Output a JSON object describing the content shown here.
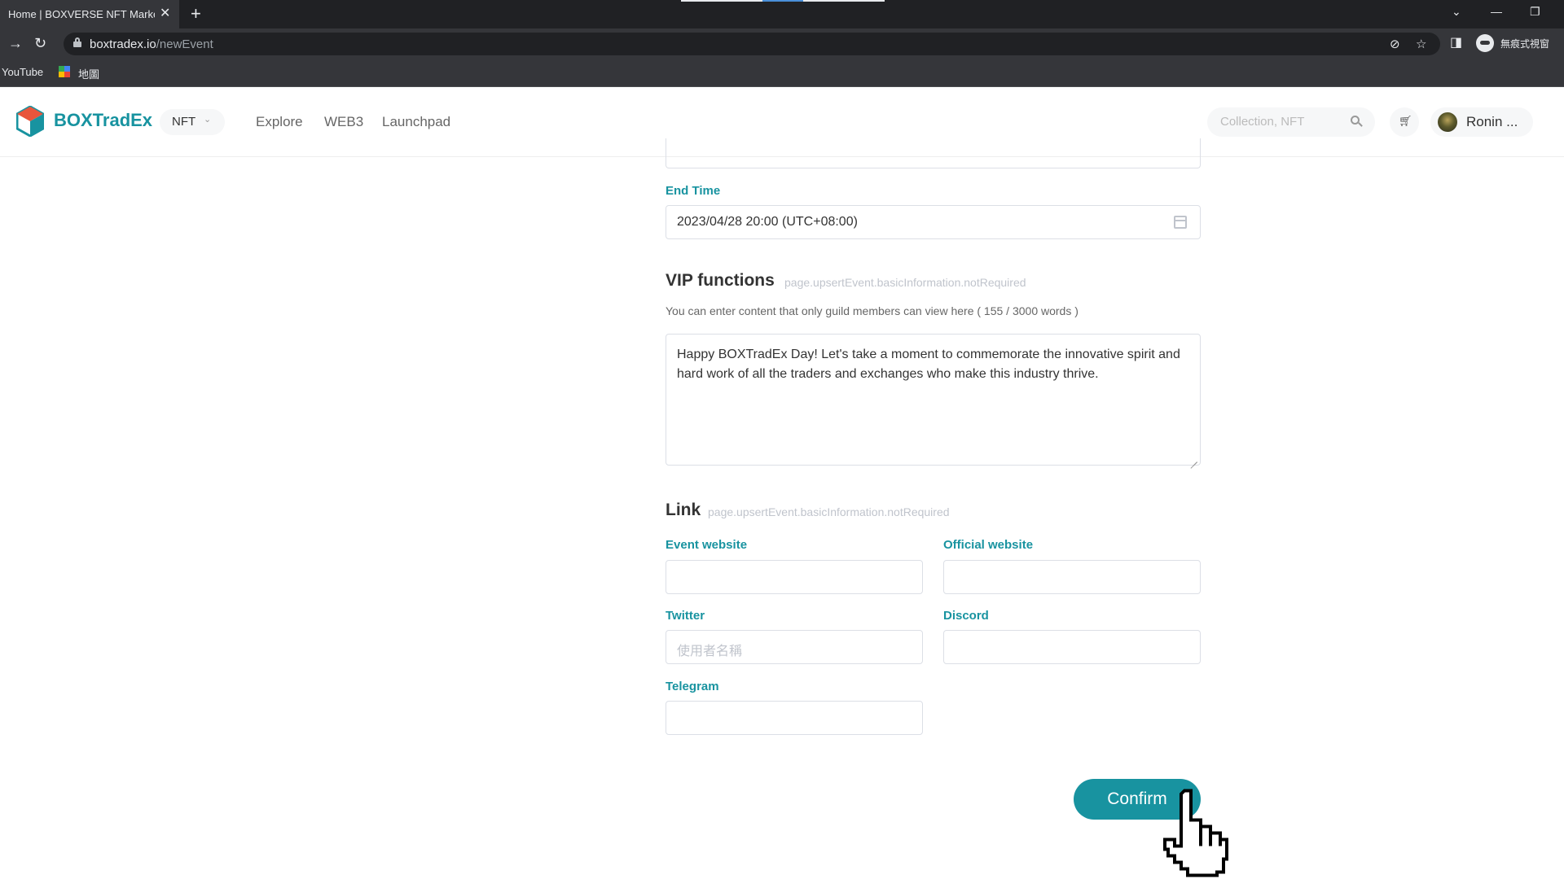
{
  "browser": {
    "tab_title": "Home | BOXVERSE NFT Market",
    "tab_close": "✕",
    "new_tab": "+",
    "url_host": "boxtradex.io",
    "url_path": "/newEvent",
    "profile_label": "無痕式視窗",
    "bookmarks": [
      "YouTube",
      "地圖"
    ],
    "window_controls": [
      "⌄",
      "—",
      "❐"
    ]
  },
  "header": {
    "brand": "BOXTradEx",
    "nft_selector": "NFT",
    "nav": [
      "Explore",
      "WEB3",
      "Launchpad"
    ],
    "search_placeholder": "Collection, NFT",
    "user_name": "Ronin ..."
  },
  "form": {
    "end_time": {
      "label": "End Time",
      "value": "2023/04/28 20:00 (UTC+08:00)"
    },
    "vip": {
      "title": "VIP functions",
      "note": "page.upsertEvent.basicInformation.notRequired",
      "help": "You can enter content that only guild members can view here ( 155 / 3000 words )",
      "content": "Happy BOXTradEx Day! Let's take a moment to commemorate the innovative spirit and hard work of all the traders and exchanges who make this industry thrive."
    },
    "link": {
      "title": "Link",
      "note": "page.upsertEvent.basicInformation.notRequired",
      "event_website_label": "Event website",
      "official_website_label": "Official website",
      "twitter_label": "Twitter",
      "twitter_placeholder": "使用者名稱",
      "discord_label": "Discord",
      "telegram_label": "Telegram"
    },
    "confirm_label": "Confirm"
  },
  "colors": {
    "brand_teal": "#1893a0",
    "chrome_dark": "#202124",
    "chrome_mid": "#35363a"
  }
}
